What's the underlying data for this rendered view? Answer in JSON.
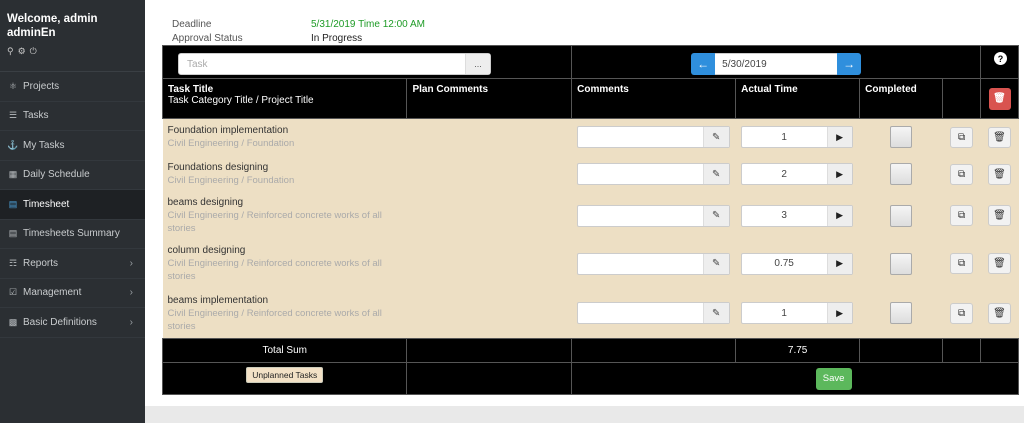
{
  "user": {
    "welcome_line1": "Welcome,  admin",
    "welcome_line2": "adminEn"
  },
  "sidebar": {
    "items": [
      {
        "label": "Projects",
        "icon": "projects-icon"
      },
      {
        "label": "Tasks",
        "icon": "tasks-icon"
      },
      {
        "label": "My Tasks",
        "icon": "my-tasks-icon"
      },
      {
        "label": "Daily Schedule",
        "icon": "calendar-icon"
      },
      {
        "label": "Timesheet",
        "icon": "timesheet-icon",
        "active": true
      },
      {
        "label": "Timesheets Summary",
        "icon": "summary-icon"
      },
      {
        "label": "Reports",
        "icon": "reports-icon"
      },
      {
        "label": "Management",
        "icon": "management-icon"
      },
      {
        "label": "Basic Definitions",
        "icon": "definitions-icon"
      }
    ]
  },
  "info": {
    "deadline_label": "Deadline",
    "deadline_value": "5/31/2019 Time 12:00 AM",
    "approval_label": "Approval Status",
    "approval_value": "In Progress"
  },
  "toolbar": {
    "task_placeholder": "Task",
    "task_browse": "...",
    "date": "5/30/2019",
    "help": "?"
  },
  "columns": {
    "task_title": "Task Title",
    "task_sub": "Task Category Title  / Project Title",
    "plan_comments": "Plan Comments",
    "comments": "Comments",
    "actual_time": "Actual Time",
    "completed": "Completed"
  },
  "rows": [
    {
      "title": "Foundation implementation",
      "category": "Civil Engineering  / Foundation",
      "time": "1"
    },
    {
      "title": "Foundations designing",
      "category": "Civil Engineering  / Foundation",
      "time": "2"
    },
    {
      "title": "beams designing",
      "category": "Civil Engineering  / Reinforced concrete works of all stories",
      "time": "3"
    },
    {
      "title": "column designing",
      "category": "Civil Engineering  / Reinforced concrete works of all stories",
      "time": "0.75"
    },
    {
      "title": "beams implementation",
      "category": "Civil Engineering  / Reinforced concrete works of all stories",
      "time": "1"
    }
  ],
  "footer": {
    "total_label": "Total Sum",
    "total_value": "7.75",
    "unplanned_label": "Unplanned Tasks",
    "save_label": "Save"
  },
  "colors": {
    "sidebar_bg": "#2b2f33",
    "row_bg": "#eddfc4",
    "accent_blue": "#2f8fdd",
    "save_green": "#5cb85c",
    "delete_red": "#d9534f",
    "deadline_green": "#1e9b26"
  }
}
